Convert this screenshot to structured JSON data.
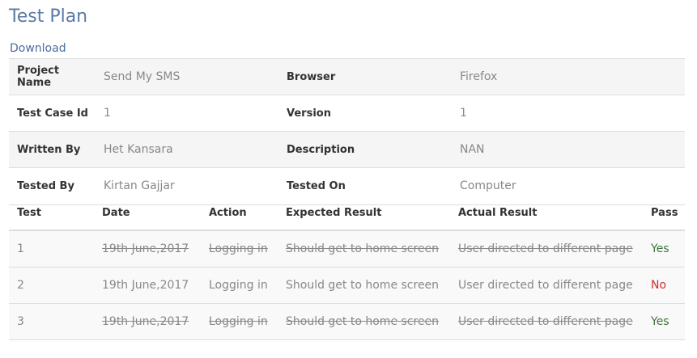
{
  "title": "Test Plan",
  "download_label": "Download",
  "info": {
    "project_name_label": "Project Name",
    "project_name": "Send My SMS",
    "browser_label": "Browser",
    "browser": "Firefox",
    "test_case_id_label": "Test Case Id",
    "test_case_id": "1",
    "version_label": "Version",
    "version": "1",
    "written_by_label": "Written By",
    "written_by": "Het Kansara",
    "description_label": "Description",
    "description": "NAN",
    "tested_by_label": "Tested By",
    "tested_by": "Kirtan Gajjar",
    "tested_on_label": "Tested On",
    "tested_on": "Computer"
  },
  "results": {
    "headers": [
      "Test",
      "Date",
      "Action",
      "Expected Result",
      "Actual Result",
      "Pass"
    ],
    "rows": [
      {
        "test": "1",
        "date": "19th June,2017",
        "action": "Logging in",
        "expected": "Should get to home screen",
        "actual": "User directed to different page",
        "pass": "Yes"
      },
      {
        "test": "2",
        "date": "19th June,2017",
        "action": "Logging in",
        "expected": "Should get to home screen",
        "actual": "User directed to different page",
        "pass": "No"
      },
      {
        "test": "3",
        "date": "19th June,2017",
        "action": "Logging in",
        "expected": "Should get to home screen",
        "actual": "User directed to different page",
        "pass": "Yes"
      }
    ]
  },
  "colors": {
    "title": "#5b7aa6",
    "pass_yes": "#3c763d",
    "pass_no": "#c9302c"
  }
}
